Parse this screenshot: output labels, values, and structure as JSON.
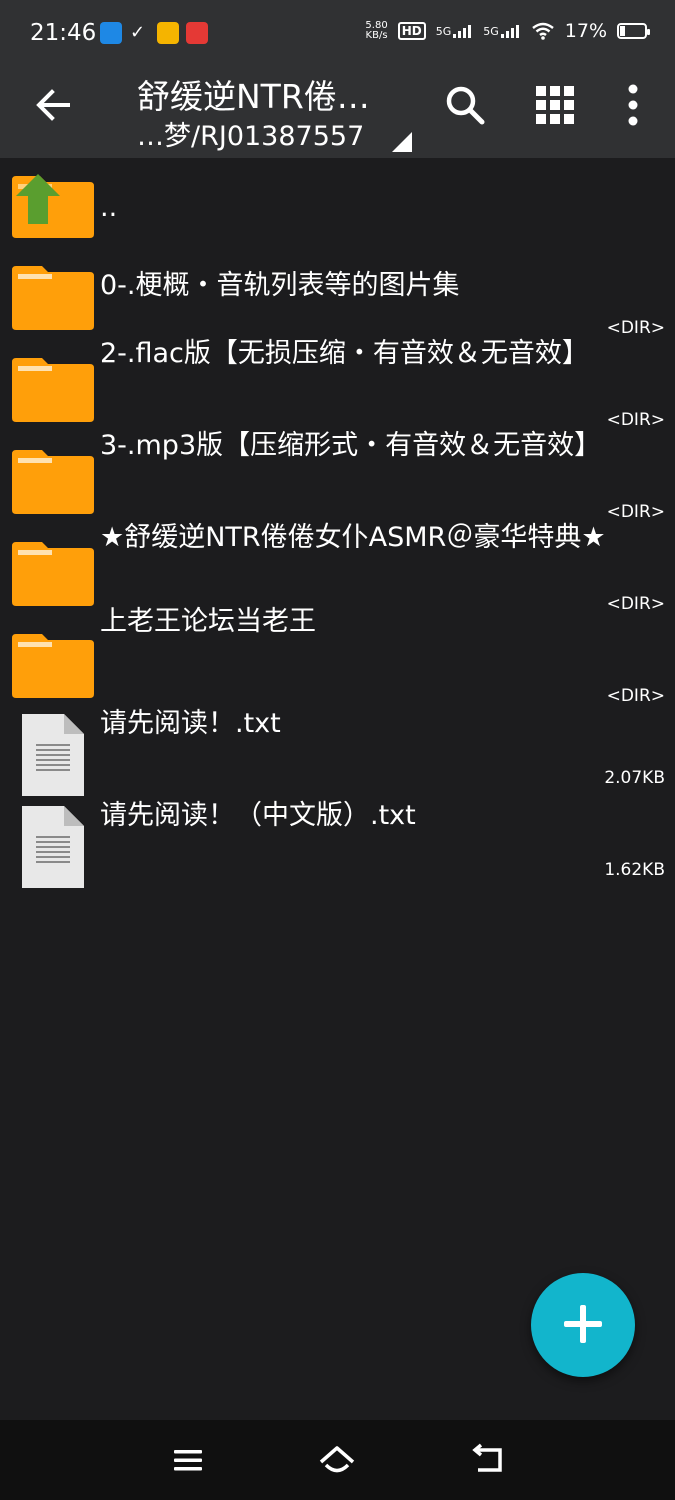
{
  "status_bar": {
    "time": "21:46",
    "net_speed_value": "5.80",
    "net_speed_unit": "KB/s",
    "hd_label": "HD",
    "sim1_label": "5G",
    "sim2_label": "5G",
    "battery": "17%",
    "notification_icons": [
      "app-notification-icon-blue",
      "check-list-icon",
      "app-notification-icon-yellow",
      "app-notification-icon-red"
    ]
  },
  "app_bar": {
    "title": "舒缓逆NTR倦…",
    "subtitle": "…梦/RJ01387557"
  },
  "files": [
    {
      "name": "..",
      "type": "parent",
      "meta": ""
    },
    {
      "name": "0-.梗概・音轨列表等的图片集",
      "type": "folder",
      "meta": "<DIR>"
    },
    {
      "name": "2-.flac版【无损压缩・有音效＆无音效】",
      "type": "folder",
      "meta": "<DIR>"
    },
    {
      "name": "3-.mp3版【压缩形式・有音效＆无音效】",
      "type": "folder",
      "meta": "<DIR>"
    },
    {
      "name": "★舒缓逆NTR倦倦女仆ASMR＠豪华特典★",
      "type": "folder",
      "meta": "<DIR>"
    },
    {
      "name": "上老王论坛当老王",
      "type": "folder",
      "meta": "<DIR>"
    },
    {
      "name": "请先阅读！.txt",
      "type": "file",
      "meta": "2.07KB"
    },
    {
      "name": "请先阅读！（中文版）.txt",
      "type": "file",
      "meta": "1.62KB"
    }
  ],
  "colors": {
    "folder": "#ff9f0a",
    "folder_tab": "#ffae1f",
    "up_arrow": "#5a9e2f",
    "fab": "#12b5cc",
    "background": "#1c1c1e",
    "bar": "#303133"
  }
}
